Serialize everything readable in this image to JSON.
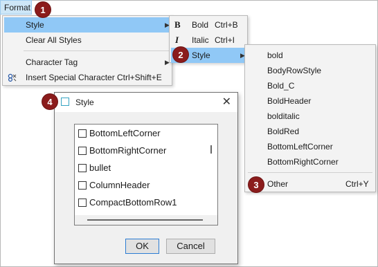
{
  "menubar": {
    "format": "Format"
  },
  "badges": [
    "1",
    "2",
    "3",
    "4"
  ],
  "format_menu": {
    "items": [
      {
        "label": "Style",
        "shortcut": ""
      },
      {
        "label": "Clear All Styles",
        "shortcut": ""
      },
      {
        "label": "Character Tag",
        "shortcut": ""
      },
      {
        "label": "Insert Special Character",
        "shortcut": "Ctrl+Shift+E"
      }
    ]
  },
  "style_menu": {
    "items": [
      {
        "icon_text": "B",
        "label": "Bold",
        "shortcut": "Ctrl+B"
      },
      {
        "icon_text": "I",
        "label": "Italic",
        "shortcut": "Ctrl+I"
      },
      {
        "label": "Style"
      }
    ]
  },
  "styles_list_menu": {
    "items": [
      "bold",
      "BodyRowStyle",
      "Bold_C",
      "BoldHeader",
      "bolditalic",
      "BoldRed",
      "BottomLeftCorner",
      "BottomRightCorner"
    ],
    "other": {
      "label": "Other",
      "shortcut": "Ctrl+Y"
    }
  },
  "dialog": {
    "title": "Style",
    "items": [
      "BottomLeftCorner",
      "BottomRightCorner",
      "bullet",
      "ColumnHeader",
      "CompactBottomRow1"
    ],
    "ok": "OK",
    "cancel": "Cancel"
  },
  "colors": {
    "highlight": "#90c8f6",
    "badge": "#8b1c1c",
    "menu_bg": "#f3f3f3"
  }
}
